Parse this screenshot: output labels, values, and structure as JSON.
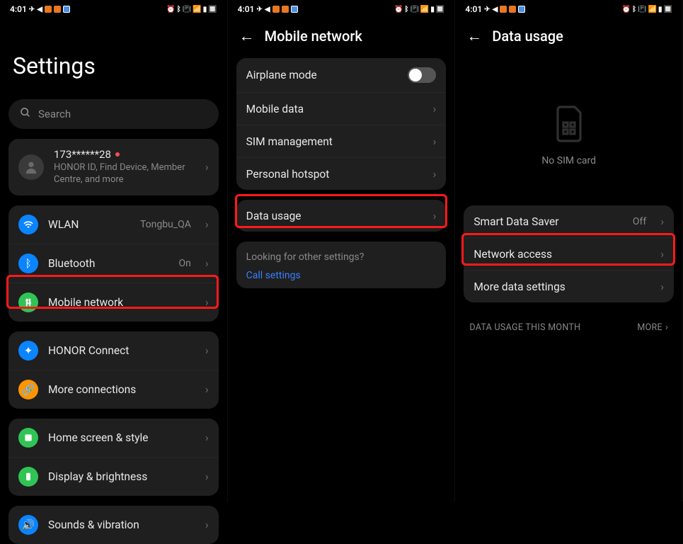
{
  "status": {
    "time": "4:01"
  },
  "panel1": {
    "title": "Settings",
    "search_placeholder": "Search",
    "account": {
      "title": "173******28",
      "subtitle": "HONOR ID, Find Device, Member Centre, and more"
    },
    "group1": [
      {
        "label": "WLAN",
        "value": "Tongbu_QA",
        "icon": "wifi"
      },
      {
        "label": "Bluetooth",
        "value": "On",
        "icon": "bluetooth"
      },
      {
        "label": "Mobile network",
        "value": "",
        "icon": "mobile"
      }
    ],
    "group2": [
      {
        "label": "HONOR Connect",
        "icon": "honor"
      },
      {
        "label": "More connections",
        "icon": "more"
      }
    ],
    "group3": [
      {
        "label": "Home screen & style",
        "icon": "home"
      },
      {
        "label": "Display & brightness",
        "icon": "display"
      }
    ],
    "group4": [
      {
        "label": "Sounds & vibration",
        "icon": "sound"
      }
    ]
  },
  "panel2": {
    "title": "Mobile network",
    "items": [
      {
        "label": "Airplane mode",
        "type": "toggle"
      },
      {
        "label": "Mobile data",
        "type": "nav"
      },
      {
        "label": "SIM management",
        "type": "nav"
      },
      {
        "label": "Personal hotspot",
        "type": "nav"
      }
    ],
    "data_usage_label": "Data usage",
    "info_text": "Looking for other settings?",
    "info_link": "Call settings"
  },
  "panel3": {
    "title": "Data usage",
    "no_sim": "No SIM card",
    "items": [
      {
        "label": "Smart Data Saver",
        "value": "Off"
      },
      {
        "label": "Network access",
        "value": ""
      },
      {
        "label": "More data settings",
        "value": ""
      }
    ],
    "section_label": "DATA USAGE THIS MONTH",
    "more_label": "MORE"
  }
}
